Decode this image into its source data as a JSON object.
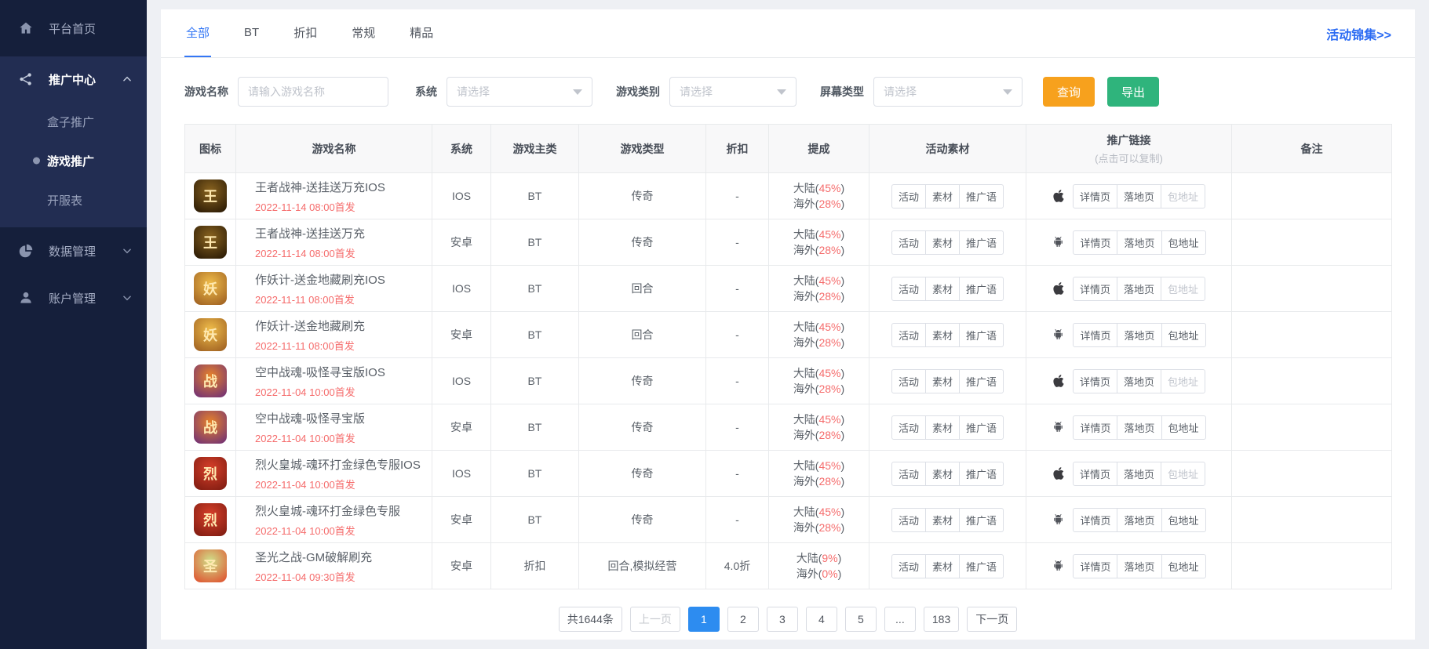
{
  "sidebar": {
    "items": [
      {
        "label": "平台首页",
        "icon": "home"
      },
      {
        "label": "推广中心",
        "icon": "share",
        "expanded": true,
        "children": [
          {
            "label": "盒子推广",
            "active": false
          },
          {
            "label": "游戏推广",
            "active": true
          },
          {
            "label": "开服表",
            "active": false
          }
        ]
      },
      {
        "label": "数据管理",
        "icon": "pie"
      },
      {
        "label": "账户管理",
        "icon": "user"
      }
    ]
  },
  "header": {
    "tabs": [
      "全部",
      "BT",
      "折扣",
      "常规",
      "精品"
    ],
    "active_tab": "全部",
    "promo_link": "活动锦集>>"
  },
  "filters": {
    "game_name_label": "游戏名称",
    "game_name_placeholder": "请输入游戏名称",
    "system_label": "系统",
    "category_label": "游戏类别",
    "screen_label": "屏幕类型",
    "select_placeholder": "请选择",
    "search_button": "查询",
    "export_button": "导出"
  },
  "table": {
    "columns": [
      "图标",
      "游戏名称",
      "系统",
      "游戏主类",
      "游戏类型",
      "折扣",
      "提成",
      "活动素材",
      "推广链接",
      "备注"
    ],
    "link_header_sub": "(点击可以复制)",
    "material_buttons": [
      "活动",
      "素材",
      "推广语"
    ],
    "link_buttons": [
      "详情页",
      "落地页",
      "包地址"
    ],
    "mainland_prefix": "大陆",
    "overseas_prefix": "海外",
    "rows": [
      {
        "name": "王者战神-送挂送万充IOS",
        "release": "2022-11-14 08:00首发",
        "system": "IOS",
        "main_type": "BT",
        "game_type": "传奇",
        "discount": "-",
        "mainland": "45%",
        "overseas": "28%",
        "platform": "ios",
        "package_disabled": true,
        "remark": "",
        "icon_colors": [
          "#8a6420",
          "#241503"
        ],
        "icon_text": "王"
      },
      {
        "name": "王者战神-送挂送万充",
        "release": "2022-11-14 08:00首发",
        "system": "安卓",
        "main_type": "BT",
        "game_type": "传奇",
        "discount": "-",
        "mainland": "45%",
        "overseas": "28%",
        "platform": "android",
        "package_disabled": false,
        "remark": "",
        "icon_colors": [
          "#8a6420",
          "#241503"
        ],
        "icon_text": "王"
      },
      {
        "name": "作妖计-送金地藏刷充IOS",
        "release": "2022-11-11 08:00首发",
        "system": "IOS",
        "main_type": "BT",
        "game_type": "回合",
        "discount": "-",
        "mainland": "45%",
        "overseas": "28%",
        "platform": "ios",
        "package_disabled": true,
        "remark": "",
        "icon_colors": [
          "#f0bd4a",
          "#9a5b1f"
        ],
        "icon_text": "妖"
      },
      {
        "name": "作妖计-送金地藏刷充",
        "release": "2022-11-11 08:00首发",
        "system": "安卓",
        "main_type": "BT",
        "game_type": "回合",
        "discount": "-",
        "mainland": "45%",
        "overseas": "28%",
        "platform": "android",
        "package_disabled": false,
        "remark": "",
        "icon_colors": [
          "#f0bd4a",
          "#9a5b1f"
        ],
        "icon_text": "妖"
      },
      {
        "name": "空中战魂-吸怪寻宝版IOS",
        "release": "2022-11-04 10:00首发",
        "system": "IOS",
        "main_type": "BT",
        "game_type": "传奇",
        "discount": "-",
        "mainland": "45%",
        "overseas": "28%",
        "platform": "ios",
        "package_disabled": true,
        "remark": "",
        "icon_colors": [
          "#e8832a",
          "#6a2c7a"
        ],
        "icon_text": "战"
      },
      {
        "name": "空中战魂-吸怪寻宝版",
        "release": "2022-11-04 10:00首发",
        "system": "安卓",
        "main_type": "BT",
        "game_type": "传奇",
        "discount": "-",
        "mainland": "45%",
        "overseas": "28%",
        "platform": "android",
        "package_disabled": false,
        "remark": "",
        "icon_colors": [
          "#e8832a",
          "#6a2c7a"
        ],
        "icon_text": "战"
      },
      {
        "name": "烈火皇城-魂环打金绿色专服IOS",
        "release": "2022-11-04 10:00首发",
        "system": "IOS",
        "main_type": "BT",
        "game_type": "传奇",
        "discount": "-",
        "mainland": "45%",
        "overseas": "28%",
        "platform": "ios",
        "package_disabled": true,
        "remark": "",
        "icon_colors": [
          "#d8402a",
          "#7a1a10"
        ],
        "icon_text": "烈"
      },
      {
        "name": "烈火皇城-魂环打金绿色专服",
        "release": "2022-11-04 10:00首发",
        "system": "安卓",
        "main_type": "BT",
        "game_type": "传奇",
        "discount": "-",
        "mainland": "45%",
        "overseas": "28%",
        "platform": "android",
        "package_disabled": false,
        "remark": "",
        "icon_colors": [
          "#d8402a",
          "#7a1a10"
        ],
        "icon_text": "烈"
      },
      {
        "name": "圣光之战-GM破解刷充",
        "release": "2022-11-04 09:30首发",
        "system": "安卓",
        "main_type": "折扣",
        "game_type": "回合,模拟经营",
        "discount": "4.0折",
        "mainland": "9%",
        "overseas": "0%",
        "platform": "android",
        "package_disabled": false,
        "remark": "",
        "icon_colors": [
          "#cfe08a",
          "#e04a2a"
        ],
        "icon_text": "圣"
      }
    ]
  },
  "pagination": {
    "total": "共1644条",
    "prev": "上一页",
    "pages": [
      "1",
      "2",
      "3",
      "4",
      "5",
      "...",
      "183"
    ],
    "active_page": "1",
    "next": "下一页"
  },
  "colors": {
    "accent_blue": "#3477f5",
    "link_blue": "#2b6bf3",
    "date_red": "#f56c6c",
    "search_orange": "#f7a11d",
    "export_green": "#2fb47c",
    "pagination_active": "#2d8cf0",
    "sidebar_bg": "#151f3b",
    "sidebar_group_bg": "#222d52"
  }
}
